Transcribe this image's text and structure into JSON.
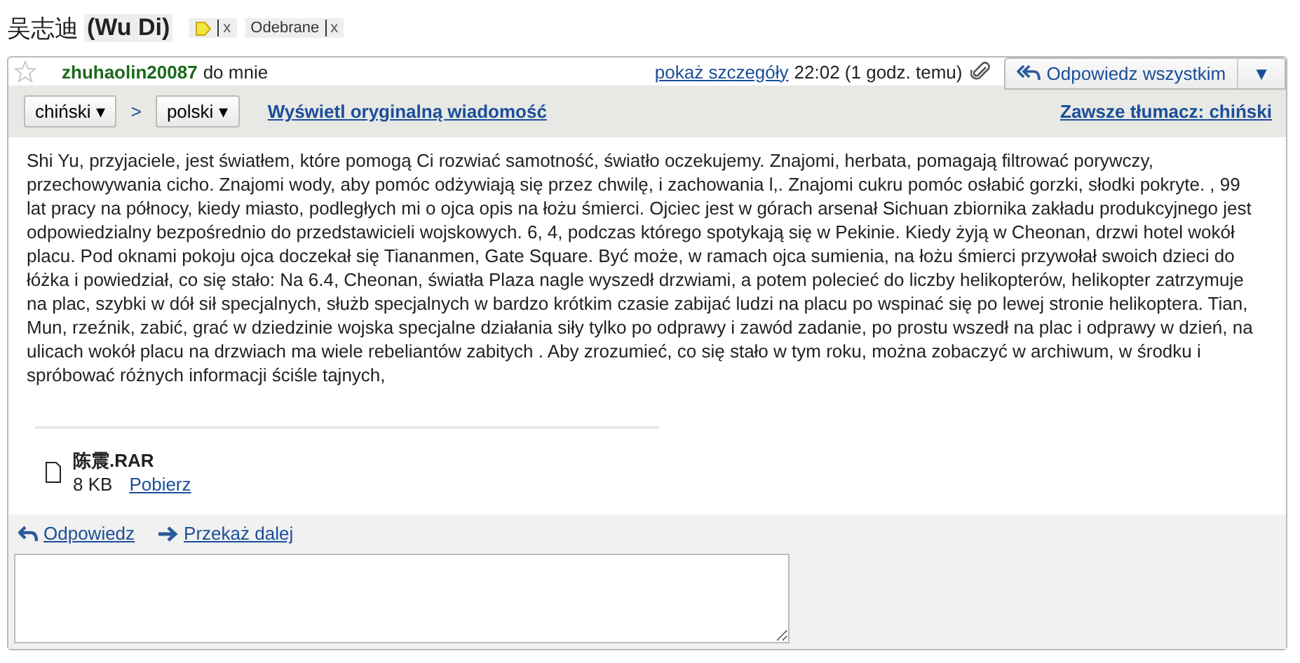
{
  "subject": {
    "text": "吴志迪",
    "highlight": "(Wu Di)"
  },
  "labels": [
    {
      "kind": "tag",
      "close": "x",
      "color": "#f5e642"
    },
    {
      "kind": "text",
      "text": "Odebrane",
      "close": "x"
    }
  ],
  "message": {
    "starred": false,
    "sender": "zhuhaolin20087",
    "recipient": "do mnie",
    "details_link": "pokaż szczegóły",
    "time": "22:02 (1 godz. temu)",
    "has_attachment": true,
    "reply_all": "Odpowiedz wszystkim",
    "menu_caret": "▼"
  },
  "translate_bar": {
    "from": "chiński ▾",
    "separator": ">",
    "to": "polski ▾",
    "show_original": "Wyświetl oryginalną wiadomość",
    "always_translate": "Zawsze tłumacz: chiński"
  },
  "body": "Shi Yu, przyjaciele, jest światłem, które pomogą Ci rozwiać samotność, światło oczekujemy. Znajomi, herbata, pomagają filtrować porywczy, przechowywania cicho. Znajomi wody, aby pomóc odżywiają się przez chwilę, i zachowania l,. Znajomi cukru pomóc osłabić gorzki, słodki pokryte. , 99 lat pracy na północy, kiedy miasto, podległych mi o ojca opis na łożu śmierci. Ojciec jest w górach arsenał Sichuan zbiornika zakładu produkcyjnego jest odpowiedzialny bezpośrednio do przedstawicieli wojskowych. 6, 4, podczas którego spotykają się w Pekinie. Kiedy żyją w Cheonan, drzwi hotel wokół placu. Pod oknami pokoju ojca doczekał się Tiananmen, Gate Square. Być może, w ramach ojca sumienia, na łożu śmierci przywołał swoich dzieci do łóżka i powiedział, co się stało: Na 6.4, Cheonan, światła Plaza nagle wyszedł drzwiami, a potem polecieć do liczby helikopterów, helikopter zatrzymuje na plac, szybki w dół sił specjalnych, służb specjalnych w bardzo krótkim czasie zabijać ludzi na placu po wspinać się po lewej stronie helikoptera. Tian, Mun, rzeźnik, zabić, grać w dziedzinie wojska specjalne działania siły tylko po odprawy i zawód zadanie, po prostu wszedł na plac i odprawy w dzień, na ulicach wokół placu na drzwiach ma wiele rebeliantów zabitych . Aby zrozumieć, co się stało w tym roku, można zobaczyć w archiwum, w środku i spróbować różnych informacji ściśle tajnych,",
  "attachment": {
    "name": "陈震.RAR",
    "size": "8 KB",
    "download": "Pobierz"
  },
  "actions": [
    {
      "kind": "reply",
      "label": "Odpowiedz"
    },
    {
      "kind": "forward",
      "label": "Przekaż dalej"
    }
  ]
}
